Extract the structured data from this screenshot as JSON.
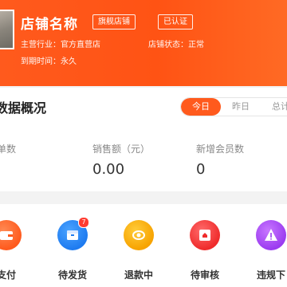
{
  "store": {
    "name": "店铺名称",
    "badges": [
      "旗舰店铺",
      "已认证"
    ],
    "industry": "主营行业：官方直营店",
    "status": "店铺状态：正常",
    "expire": "到期时间：永久"
  },
  "overview": {
    "title": "数据概况",
    "tabs": [
      "今日",
      "昨日",
      "总计"
    ],
    "active_tab": 0,
    "stats": [
      {
        "label": "单数",
        "value": ""
      },
      {
        "label": "销售额（元）",
        "value": "0.00"
      },
      {
        "label": "新增会员数",
        "value": "0"
      }
    ]
  },
  "orders": {
    "items": [
      {
        "label": "支付",
        "icon": "wallet-icon",
        "color": "#ff5a1d"
      },
      {
        "label": "待发货",
        "icon": "box-icon",
        "color": "#1e7bf0",
        "badge": "7"
      },
      {
        "label": "退款中",
        "icon": "refund-icon",
        "color": "#f7a300"
      },
      {
        "label": "待审核",
        "icon": "review-icon",
        "color": "#ef2b2b"
      },
      {
        "label": "违规下",
        "icon": "warning-icon",
        "color": "#9b3cf0"
      }
    ]
  }
}
